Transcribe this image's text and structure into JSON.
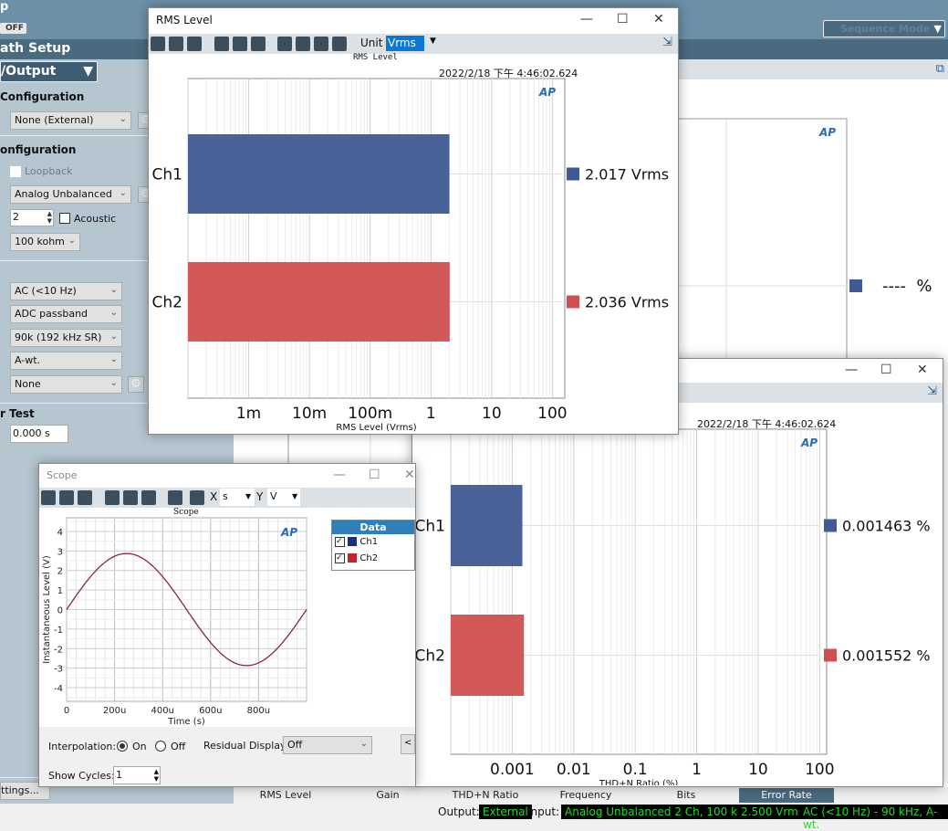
{
  "app": {
    "title_fragment": "p",
    "toggle": "OFF",
    "section": "ath Setup",
    "path_dropdown": "/Output",
    "sequence_mode": "Sequence Mode"
  },
  "left": {
    "output_config_hdr": "Configuration",
    "output_select": "None (External)",
    "input_config_hdr": "onfiguration",
    "loopback": "Loopback",
    "input_select": "Analog Unbalanced",
    "channels": "2",
    "acoustic": "Acoustic",
    "impedance": "100 kohm",
    "coupling": "AC (<10 Hz)",
    "bandwidth": "ADC passband",
    "filter_hp": "90k (192 kHz SR)",
    "weighting": "A-wt.",
    "filter_extra": "None",
    "delay_hdr": "r Test",
    "delay": "0.000 s",
    "settings_btn": "ttings..."
  },
  "bg_panel": {
    "value": "----  %",
    "legend_color": "#3f5a95"
  },
  "tabs": [
    "RMS Level",
    "Gain",
    "THD+N Ratio",
    "Frequency",
    "Bits",
    "Error Rate"
  ],
  "active_tab": "Error Rate",
  "status": {
    "output_label": "Output:",
    "output": "External",
    "input_label": "Input:",
    "input": "Analog Unbalanced 2 Ch, 100 kohm",
    "range": "2.500 Vrms",
    "filter": "AC (<10 Hz) - 90 kHz, A-wt."
  },
  "rms_window": {
    "title": "RMS Level",
    "unit_label": "Unit",
    "unit": "Vrms",
    "timestamp": "2022/2/18 下午 4:46:02.624"
  },
  "thd_window": {
    "timestamp": "2022/2/18 下午 4:46:02.624"
  },
  "scope_window": {
    "title": "Scope",
    "x_label": "X",
    "x_unit": "s",
    "y_label": "Y",
    "y_unit": "V",
    "legend_header": "Data",
    "interp_label": "Interpolation:",
    "on": "On",
    "off": "Off",
    "interp_value": "On",
    "residual_label": "Residual Display:",
    "residual": "Off",
    "cycles_label": "Show Cycles:",
    "cycles": "1"
  },
  "chart_data": [
    {
      "type": "bar",
      "orientation": "horizontal",
      "title": "RMS Level",
      "xlabel": "RMS Level (Vrms)",
      "xscale": "log",
      "xlim": [
        0.0001,
        160
      ],
      "xticks": [
        "1m",
        "10m",
        "100m",
        "1",
        "10",
        "100"
      ],
      "xtickvals": [
        0.001,
        0.01,
        0.1,
        1,
        10,
        100
      ],
      "categories": [
        "Ch1",
        "Ch2"
      ],
      "values": [
        2.017,
        2.036
      ],
      "labels": [
        "2.017  Vrms",
        "2.036  Vrms"
      ],
      "colors": [
        "#3f5a95",
        "#d0504f"
      ],
      "grid": true
    },
    {
      "type": "bar",
      "orientation": "horizontal",
      "title": "",
      "xlabel": "THD+N Ratio (%)",
      "xscale": "log",
      "xlim": [
        0.0001,
        130
      ],
      "xticks": [
        "0.001",
        "0.01",
        "0.1",
        "1",
        "10",
        "100"
      ],
      "xtickvals": [
        0.001,
        0.01,
        0.1,
        1,
        10,
        100
      ],
      "categories": [
        "Ch1",
        "Ch2"
      ],
      "values": [
        0.001463,
        0.001552
      ],
      "labels": [
        "0.001463  %",
        "0.001552  %"
      ],
      "colors": [
        "#3f5a95",
        "#d0504f"
      ],
      "grid": true
    },
    {
      "type": "line",
      "title": "Scope",
      "xlabel": "Time (s)",
      "ylabel": "Instantaneous Level (V)",
      "xlim": [
        0,
        0.001
      ],
      "ylim": [
        -4.7,
        4.7
      ],
      "xticks": [
        "0",
        "200u",
        "400u",
        "600u",
        "800u"
      ],
      "xtickvals": [
        0,
        0.0002,
        0.0004,
        0.0006,
        0.0008
      ],
      "yticks": [
        4,
        3,
        2,
        1,
        0,
        -1,
        -2,
        -3,
        -4
      ],
      "series": [
        {
          "name": "Ch1",
          "color": "#1a2f80",
          "amplitude": 2.87,
          "frequency_hz": 1000
        },
        {
          "name": "Ch2",
          "color": "#c8232c",
          "amplitude": 2.87,
          "frequency_hz": 1000
        }
      ],
      "grid": true
    }
  ]
}
